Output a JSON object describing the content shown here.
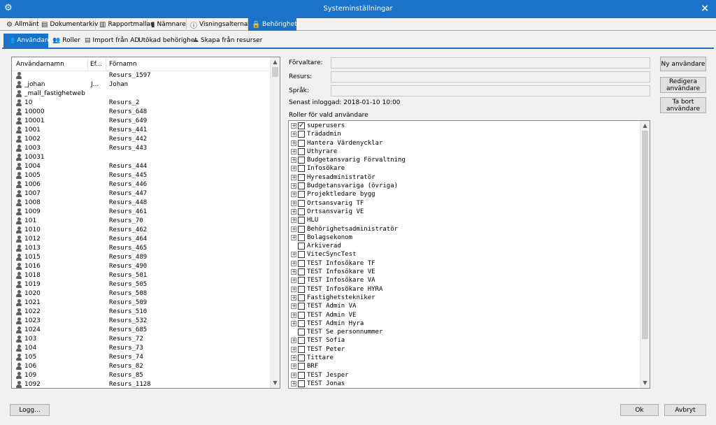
{
  "window": {
    "title": "Systeminställningar",
    "close_glyph": "×",
    "app_icon": "gears-icon"
  },
  "main_tabs": [
    {
      "label": "Allmänt",
      "icon": "gears-icon",
      "glyph": "⚙"
    },
    {
      "label": "Dokumentarkiv",
      "icon": "folder-icon",
      "glyph": "▤"
    },
    {
      "label": "Rapportmallar",
      "icon": "report-icon",
      "glyph": "▥"
    },
    {
      "label": "Nämnare",
      "icon": "bottle-icon",
      "glyph": "▮"
    },
    {
      "label": "Visningsalternativ",
      "icon": "info-icon",
      "glyph": "ⓘ"
    },
    {
      "label": "Behörigheter",
      "icon": "lock-icon",
      "glyph": "🔒"
    }
  ],
  "sub_tabs": [
    {
      "label": "Användare",
      "icon": "users-icon",
      "glyph": "👥"
    },
    {
      "label": "Roller",
      "icon": "roles-icon",
      "glyph": "👥"
    },
    {
      "label": "Import från AD",
      "icon": "import-icon",
      "glyph": "▤"
    },
    {
      "label": "Utökad behörighet",
      "icon": "",
      "glyph": ""
    },
    {
      "label": "Skapa från resurser",
      "icon": "group-icon",
      "glyph": "☁"
    }
  ],
  "users": {
    "columns": [
      "Användarnamn",
      "Ef...",
      "Förnamn"
    ],
    "rows": [
      {
        "username": "",
        "ef": "",
        "first": "Resurs_1597"
      },
      {
        "username": "_johan",
        "ef": "J...",
        "first": "Johan"
      },
      {
        "username": "_mall_fastighetweb",
        "ef": "",
        "first": ""
      },
      {
        "username": "10",
        "ef": "",
        "first": "Resurs_2"
      },
      {
        "username": "10000",
        "ef": "",
        "first": "Resurs_648"
      },
      {
        "username": "10001",
        "ef": "",
        "first": "Resurs_649"
      },
      {
        "username": "1001",
        "ef": "",
        "first": "Resurs_441"
      },
      {
        "username": "1002",
        "ef": "",
        "first": "Resurs_442"
      },
      {
        "username": "1003",
        "ef": "",
        "first": "Resurs_443"
      },
      {
        "username": "10031",
        "ef": "",
        "first": ""
      },
      {
        "username": "1004",
        "ef": "",
        "first": "Resurs_444"
      },
      {
        "username": "1005",
        "ef": "",
        "first": "Resurs_445"
      },
      {
        "username": "1006",
        "ef": "",
        "first": "Resurs_446"
      },
      {
        "username": "1007",
        "ef": "",
        "first": "Resurs_447"
      },
      {
        "username": "1008",
        "ef": "",
        "first": "Resurs_448"
      },
      {
        "username": "1009",
        "ef": "",
        "first": "Resurs_461"
      },
      {
        "username": "101",
        "ef": "",
        "first": "Resurs_70"
      },
      {
        "username": "1010",
        "ef": "",
        "first": "Resurs_462"
      },
      {
        "username": "1012",
        "ef": "",
        "first": "Resurs_464"
      },
      {
        "username": "1013",
        "ef": "",
        "first": "Resurs_465"
      },
      {
        "username": "1015",
        "ef": "",
        "first": "Resurs_489"
      },
      {
        "username": "1016",
        "ef": "",
        "first": "Resurs_490"
      },
      {
        "username": "1018",
        "ef": "",
        "first": "Resurs_501"
      },
      {
        "username": "1019",
        "ef": "",
        "first": "Resurs_505"
      },
      {
        "username": "1020",
        "ef": "",
        "first": "Resurs_508"
      },
      {
        "username": "1021",
        "ef": "",
        "first": "Resurs_509"
      },
      {
        "username": "1022",
        "ef": "",
        "first": "Resurs_510"
      },
      {
        "username": "1023",
        "ef": "",
        "first": "Resurs_532"
      },
      {
        "username": "1024",
        "ef": "",
        "first": "Resurs_685"
      },
      {
        "username": "103",
        "ef": "",
        "first": "Resurs_72"
      },
      {
        "username": "104",
        "ef": "",
        "first": "Resurs_73"
      },
      {
        "username": "105",
        "ef": "",
        "first": "Resurs_74"
      },
      {
        "username": "106",
        "ef": "",
        "first": "Resurs_82"
      },
      {
        "username": "109",
        "ef": "",
        "first": "Resurs_85"
      },
      {
        "username": "1092",
        "ef": "",
        "first": "Resurs_1128"
      }
    ]
  },
  "form": {
    "forvaltare_label": "Förvaltare:",
    "resurs_label": "Resurs:",
    "sprak_label": "Språk:",
    "forvaltare_value": "",
    "resurs_value": "",
    "sprak_value": "",
    "last_login": "Senast inloggad: 2018-01-10 10:00",
    "roles_title": "Roller för vald användare"
  },
  "roles": [
    {
      "label": "superusers",
      "checked": true,
      "expand": true
    },
    {
      "label": "Trädadmin",
      "checked": false,
      "expand": true
    },
    {
      "label": "Hantera Värdenycklar",
      "checked": false,
      "expand": true
    },
    {
      "label": "Uthyrare",
      "checked": false,
      "expand": true
    },
    {
      "label": "Budgetansvarig Förvaltning",
      "checked": false,
      "expand": true
    },
    {
      "label": "Infosökare",
      "checked": false,
      "expand": true
    },
    {
      "label": "Hyresadministratör",
      "checked": false,
      "expand": true
    },
    {
      "label": "Budgetansvariga (övriga)",
      "checked": false,
      "expand": true
    },
    {
      "label": "Projektledare bygg",
      "checked": false,
      "expand": true
    },
    {
      "label": "Ortsansvarig TF",
      "checked": false,
      "expand": true
    },
    {
      "label": "Ortsansvarig VE",
      "checked": false,
      "expand": true
    },
    {
      "label": "HLU",
      "checked": false,
      "expand": true
    },
    {
      "label": "Behörighetsadministratör",
      "checked": false,
      "expand": true
    },
    {
      "label": "Bolagsekonom",
      "checked": false,
      "expand": true
    },
    {
      "label": "Arkiverad",
      "checked": false,
      "expand": false
    },
    {
      "label": "VitecSyncTest",
      "checked": false,
      "expand": true
    },
    {
      "label": "TEST Infosökare TF",
      "checked": false,
      "expand": true
    },
    {
      "label": "TEST Infosökare VE",
      "checked": false,
      "expand": true
    },
    {
      "label": "TEST Infosökare VA",
      "checked": false,
      "expand": true
    },
    {
      "label": "TEST Infosökare HYRA",
      "checked": false,
      "expand": true
    },
    {
      "label": "Fastighetstekniker",
      "checked": false,
      "expand": true
    },
    {
      "label": "TEST Admin VA",
      "checked": false,
      "expand": true
    },
    {
      "label": "TEST Admin VE",
      "checked": false,
      "expand": true
    },
    {
      "label": "TEST Admin Hyra",
      "checked": false,
      "expand": true
    },
    {
      "label": "TEST Se personnummer",
      "checked": false,
      "expand": false
    },
    {
      "label": "TEST Sofia",
      "checked": false,
      "expand": true
    },
    {
      "label": "TEST Peter",
      "checked": false,
      "expand": true
    },
    {
      "label": "Tittare",
      "checked": false,
      "expand": true
    },
    {
      "label": "BRF",
      "checked": false,
      "expand": true
    },
    {
      "label": "TEST Jesper",
      "checked": false,
      "expand": true
    },
    {
      "label": "TEST Jonas",
      "checked": false,
      "expand": true
    }
  ],
  "buttons": {
    "new_user": "Ny användare",
    "edit_user_line1": "Redigera",
    "edit_user_line2": "användare",
    "delete_user_line1": "Ta bort",
    "delete_user_line2": "användare",
    "log": "Logg...",
    "ok": "Ok",
    "cancel": "Avbryt"
  },
  "scroll": {
    "up_glyph": "▲",
    "down_glyph": "▼",
    "check_glyph": "✓",
    "plus_glyph": "+"
  },
  "colors": {
    "accent": "#1a73c9",
    "window_bg": "#f0f0f0"
  }
}
